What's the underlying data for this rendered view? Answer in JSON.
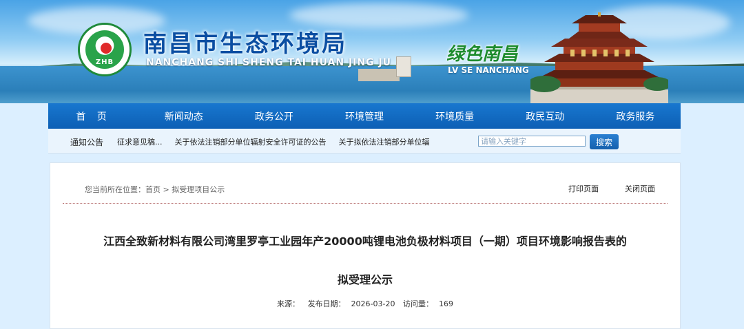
{
  "header": {
    "logo_text": "ZHB",
    "site_title": "南昌市生态环境局",
    "site_pinyin": "NANCHANG SHI SHENG TAI HUAN JING JU",
    "slogan": "绿色南昌",
    "slogan_pinyin": "LV SE NANCHANG"
  },
  "nav": {
    "items": [
      "首 页",
      "新闻动态",
      "政务公开",
      "环境管理",
      "环境质量",
      "政民互动",
      "政务服务"
    ]
  },
  "notice": {
    "label": "通知公告",
    "items": [
      "征求意见稿...",
      "关于依法注销部分单位辐射安全许可证的公告",
      "关于拟依法注销部分单位辐"
    ],
    "search_placeholder": "请输入关键字",
    "search_button": "搜索"
  },
  "content": {
    "breadcrumb": "您当前所在位置：首页 > 拟受理项目公示",
    "print_label": "打印页面",
    "close_label": "关闭页面",
    "title_line1": "江西全致新材料有限公司湾里罗亭工业园年产20000吨锂电池负极材料项目（一期）项目环境影响报告表的",
    "title_line2": "拟受理公示",
    "meta": {
      "source_label": "来源：",
      "date_label": "发布日期：",
      "date": "2026-03-20",
      "visits_label": "访问量：",
      "visits": "169"
    }
  },
  "colors": {
    "nav_blue": "#0d5fb5",
    "title_blue": "#0b4ea2",
    "slogan_green": "#1e8c2e"
  }
}
